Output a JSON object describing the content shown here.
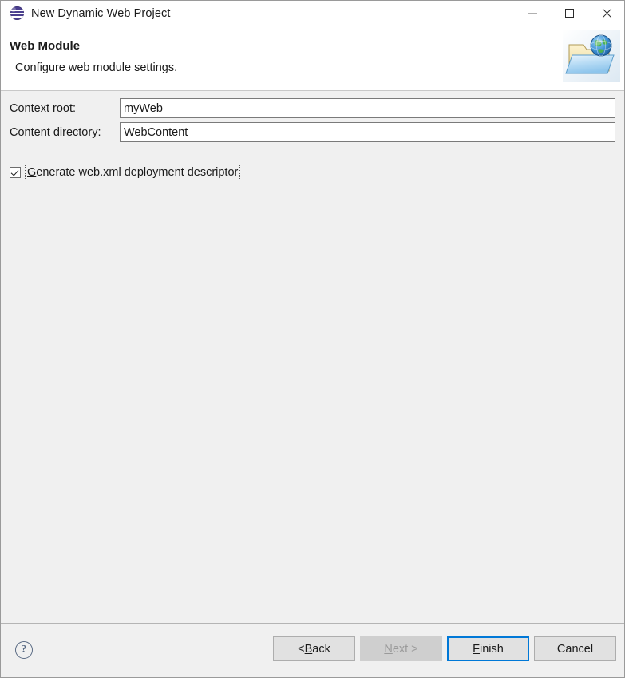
{
  "window": {
    "title": "New Dynamic Web Project",
    "app_icon": "eclipse-icon",
    "controls": {
      "minimize": "minimize-icon",
      "maximize": "maximize-icon",
      "close": "close-icon"
    }
  },
  "header": {
    "title": "Web Module",
    "description": "Configure web module settings.",
    "banner_icon": "web-project-folder-globe-icon"
  },
  "form": {
    "context_root": {
      "label_pre": "Context ",
      "label_mnemonic": "r",
      "label_post": "oot:",
      "value": "myWeb",
      "placeholder": ""
    },
    "content_directory": {
      "label_pre": "Content ",
      "label_mnemonic": "d",
      "label_post": "irectory:",
      "value": "WebContent",
      "placeholder": ""
    },
    "generate_web_xml": {
      "label_mnemonic": "G",
      "label_post": "enerate web.xml deployment descriptor",
      "checked": true
    }
  },
  "footer": {
    "help_icon": "help-question-icon",
    "help_glyph": "?",
    "buttons": {
      "back": {
        "pre": "< ",
        "mnemonic": "B",
        "post": "ack",
        "enabled": true,
        "default": false
      },
      "next": {
        "pre": "",
        "mnemonic": "N",
        "post": "ext >",
        "enabled": false,
        "default": false
      },
      "finish": {
        "pre": "",
        "mnemonic": "F",
        "post": "inish",
        "enabled": true,
        "default": true
      },
      "cancel": {
        "pre": "",
        "mnemonic": "",
        "post": "Cancel",
        "enabled": true,
        "default": false
      }
    }
  },
  "colors": {
    "accent": "#0078d7",
    "body_bg": "#f0f0f0",
    "header_bg": "#ffffff",
    "text": "#1a1a1a",
    "disabled_text": "#9a9a9a"
  }
}
